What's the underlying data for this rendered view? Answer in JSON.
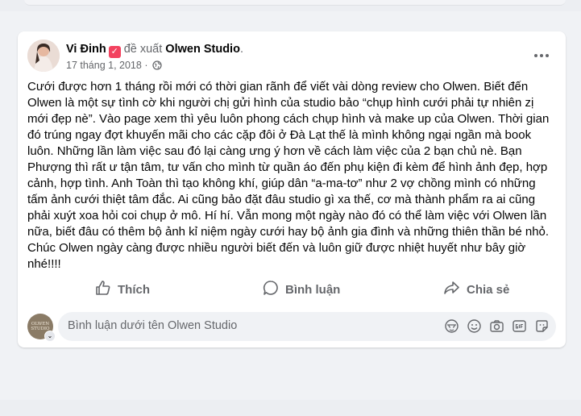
{
  "post": {
    "author": "Vi Đinh",
    "verb": "đề xuất",
    "page_name": "Olwen Studio",
    "period": ".",
    "date": "17 tháng 1, 2018",
    "dot": "·",
    "text": "Cưới được hơn 1 tháng rồi mới có thời gian rãnh để viết vài dòng review cho Olwen. Biết đến Olwen là một sự tình cờ khi người chị gửi hình của studio bảo “chụp hình cưới phải tự nhiên zị mới đẹp nè”. Vào page xem thì yêu luôn phong cách chụp hình và make up của Olwen. Thời gian đó trúng ngay đợt khuyến mãi cho các cặp đôi ở Đà Lạt thế là mình không ngại ngần mà book luôn. Những lần làm việc sau đó lại càng ưng ý hơn về cách làm việc của 2 bạn chủ nè. Bạn Phượng thì rất ư tận tâm, tư vấn cho mình từ quần áo đến phụ kiện đi kèm để hình ảnh đẹp, hợp cảnh, hợp tình. Anh Toàn thì tạo không khí, giúp dân “a-ma-tơ” như 2 vợ chồng mình có những tấm ảnh cưới thiệt tâm đắc. Ai cũng bảo đặt đâu studio gì xa thế, cơ mà thành phẩm ra ai cũng phải xuýt xoa hỏi coi chụp ở mô. Hí hí. Vẫn mong một ngày nào đó có thể làm việc với Olwen lần nữa, biết đâu có thêm bộ ảnh kỉ niệm ngày cưới hay bộ ảnh gia đình và những thiên thần bé nhỏ. Chúc Olwen ngày càng được nhiều người biết đến và luôn giữ được nhiệt huyết như bây giờ nhé!!!!"
  },
  "actions": {
    "like": "Thích",
    "comment": "Bình luận",
    "share": "Chia sẻ"
  },
  "comment_box": {
    "placeholder": "Bình luận dưới tên Olwen Studio",
    "avatar_text": "OLWEN STUDIO",
    "icons": [
      "avatar-sticker-icon",
      "emoji-icon",
      "camera-icon",
      "gif-icon",
      "sticker-icon"
    ]
  },
  "colors": {
    "background": "#f0f2f5",
    "card": "#ffffff",
    "secondary_text": "#65676b",
    "badge": "#f3425f"
  }
}
